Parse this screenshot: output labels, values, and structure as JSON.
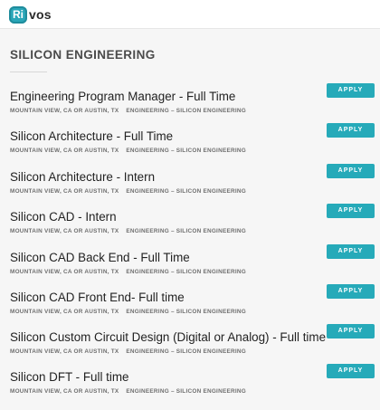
{
  "header": {
    "logo_mark": "Ri",
    "logo_text": "vos"
  },
  "section": {
    "title": "SILICON ENGINEERING"
  },
  "postings": [
    {
      "title": "Engineering Program Manager - Full Time",
      "location": "MOUNTAIN VIEW, CA OR AUSTIN, TX",
      "team": "ENGINEERING – SILICON ENGINEERING",
      "apply_label": "APPLY"
    },
    {
      "title": "Silicon Architecture - Full Time",
      "location": "MOUNTAIN VIEW, CA OR AUSTIN, TX",
      "team": "ENGINEERING – SILICON ENGINEERING",
      "apply_label": "APPLY"
    },
    {
      "title": "Silicon Architecture - Intern",
      "location": "MOUNTAIN VIEW, CA OR AUSTIN, TX",
      "team": "ENGINEERING – SILICON ENGINEERING",
      "apply_label": "APPLY"
    },
    {
      "title": "Silicon CAD - Intern",
      "location": "MOUNTAIN VIEW, CA OR AUSTIN, TX",
      "team": "ENGINEERING – SILICON ENGINEERING",
      "apply_label": "APPLY"
    },
    {
      "title": "Silicon CAD Back End - Full Time",
      "location": "MOUNTAIN VIEW, CA OR AUSTIN, TX",
      "team": "ENGINEERING – SILICON ENGINEERING",
      "apply_label": "APPLY"
    },
    {
      "title": "Silicon CAD Front End- Full time",
      "location": "MOUNTAIN VIEW, CA OR AUSTIN, TX",
      "team": "ENGINEERING – SILICON ENGINEERING",
      "apply_label": "APPLY"
    },
    {
      "title": "Silicon Custom Circuit Design (Digital or Analog) - Full time",
      "location": "MOUNTAIN VIEW, CA OR AUSTIN, TX",
      "team": "ENGINEERING – SILICON ENGINEERING",
      "apply_label": "APPLY"
    },
    {
      "title": "Silicon DFT - Full time",
      "location": "MOUNTAIN VIEW, CA OR AUSTIN, TX",
      "team": "ENGINEERING – SILICON ENGINEERING",
      "apply_label": "APPLY"
    }
  ]
}
